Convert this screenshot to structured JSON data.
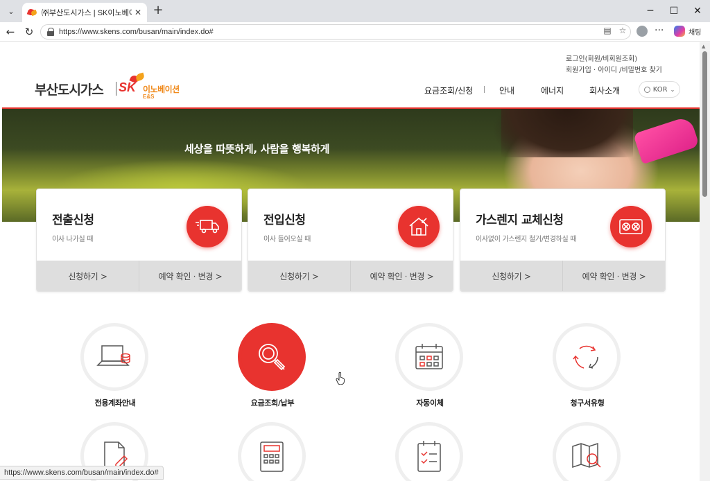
{
  "browser": {
    "tab_title": "㈜부산도시가스 | SK이노베이션 E&S",
    "url": "https://www.skens.com/busan/main/index.do#",
    "chat_label": "채팅",
    "status_url": "https://www.skens.com/busan/main/index.do#"
  },
  "header": {
    "logo_text": "부산도시가스",
    "logo_sk": "SK",
    "logo_inno": "이노베이션",
    "logo_es": "E&S",
    "util_login": "로그인(회원/비회원조회)",
    "util_join": "회원가입   · 아이디 /비밀번호 찾기",
    "nav": [
      "요금조회/신청",
      "안내",
      "에너지",
      "회사소개"
    ],
    "lang": "KOR"
  },
  "hero": {
    "title": "세상을 따뜻하게, 사람을 행복하게"
  },
  "cards": [
    {
      "title": "전출신청",
      "desc": "이사 나가실 때",
      "apply": "신청하기 >",
      "reserve": "예약 확인 · 변경 >",
      "icon": "moving-truck-icon"
    },
    {
      "title": "전입신청",
      "desc": "이사 들어오실 때",
      "apply": "신청하기 >",
      "reserve": "예약 확인 · 변경 >",
      "icon": "house-arrow-icon"
    },
    {
      "title": "가스렌지 교체신청",
      "desc": "이사없이 가스렌지 철거/변경하실 때",
      "apply": "신청하기 >",
      "reserve": "예약 확인 · 변경 >",
      "icon": "gas-stove-icon"
    }
  ],
  "quick_menu": [
    {
      "label": "전용계좌안내",
      "icon": "laptop-coins-icon",
      "active": false
    },
    {
      "label": "요금조회/납부",
      "icon": "magnifier-icon",
      "active": true
    },
    {
      "label": "자동이체",
      "icon": "calendar-icon",
      "active": false
    },
    {
      "label": "청구서유형",
      "icon": "recycle-arrows-icon",
      "active": false
    }
  ],
  "colors": {
    "accent": "#e8332f",
    "brand_orange": "#f4a21b"
  }
}
